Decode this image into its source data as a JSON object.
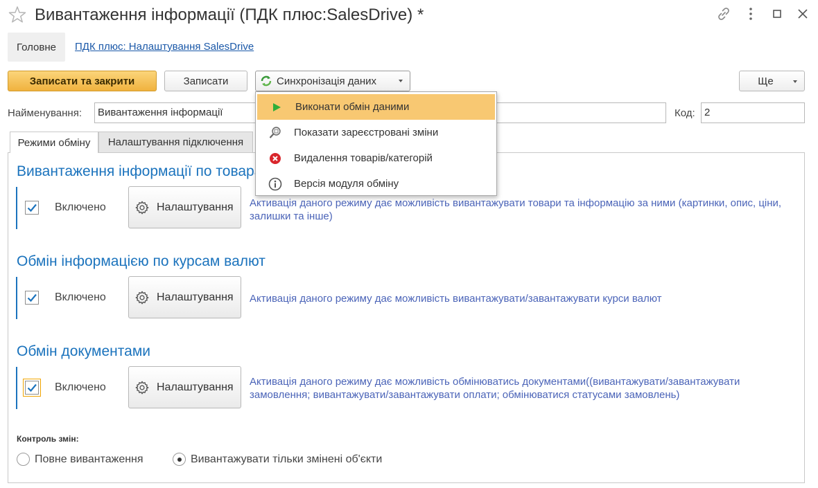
{
  "window": {
    "title": "Вивантаження інформації (ПДК плюс:SalesDrive) *",
    "icons": [
      "star-icon",
      "link-icon",
      "more-vertical-icon",
      "maximize-icon",
      "close-icon"
    ]
  },
  "nav": {
    "main_label": "Головне",
    "link_label": "ПДК плюс: Налаштування SalesDrive"
  },
  "toolbar": {
    "save_close_label": "Записати та закрити",
    "save_label": "Записати",
    "sync_label": "Синхронізація даних",
    "more_label": "Ще"
  },
  "fields": {
    "name_label": "Найменування:",
    "name_value": "Вивантаження інформації",
    "code_label": "Код:",
    "code_value": "2"
  },
  "tabs": [
    {
      "label": "Режими обміну",
      "active": true
    },
    {
      "label": "Налаштування підключення",
      "active": false
    }
  ],
  "sections": [
    {
      "title": "Вивантаження інформації по товарам",
      "checkbox_label": "Включено",
      "checked": true,
      "settings_label": "Налаштування",
      "description": "Активація даного режиму дає можливість вивантажувати товари та інформацію за ними (картинки, опис, ціни, залишки та інше)"
    },
    {
      "title": "Обмін інформацією по курсам валют",
      "checkbox_label": "Включено",
      "checked": true,
      "settings_label": "Налаштування",
      "description": "Активація даного режиму дає можливість вивантажувати/завантажувати  курси валют"
    },
    {
      "title": "Обмін документами",
      "checkbox_label": "Включено",
      "checked": true,
      "settings_label": "Налаштування",
      "description": "Активація даного режиму дає можливість обмінюватись документами((вивантажувати/завантажувати замовлення; вивантажувати/завантажувати оплати; обмінюватися статусами замовлень)"
    }
  ],
  "change_control": {
    "label": "Контроль змін:",
    "options": [
      {
        "label": "Повне вивантаження",
        "selected": false
      },
      {
        "label": "Вивантажувати тільки змінені об'єкти",
        "selected": true
      }
    ]
  },
  "sync_menu": {
    "items": [
      {
        "label": "Виконати обмін даними",
        "icon": "play-icon",
        "highlighted": true
      },
      {
        "label": "Показати зареєстровані зміни",
        "icon": "magnifier-icon",
        "highlighted": false
      },
      {
        "label": "Видалення товарів/категорій",
        "icon": "delete-icon",
        "highlighted": false
      },
      {
        "label": "Версія модуля обміну",
        "icon": "info-icon",
        "highlighted": false
      }
    ]
  },
  "colors": {
    "accent": "#1b73bd",
    "primary_button": "#f0b23f",
    "menu_highlight": "#f8c872",
    "description_text": "#4b64b8"
  }
}
